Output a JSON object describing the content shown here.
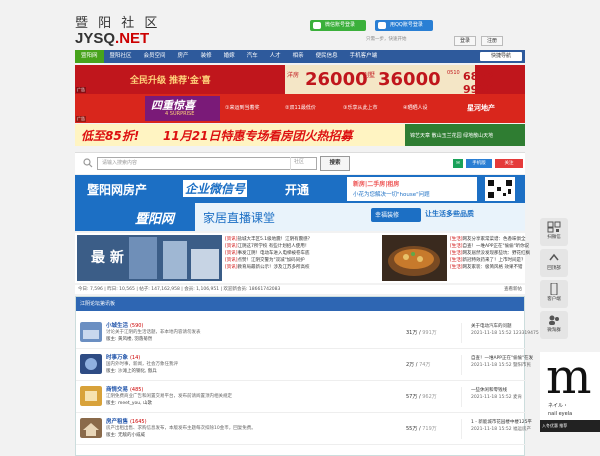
{
  "header": {
    "logo_cn": "暨 阳 社 区",
    "logo_en_a": "JYSQ",
    "logo_en_b": ".NET",
    "wechat_login": "微信账号登录",
    "qq_login": "用QQ账号登录",
    "login_line": "只需一步，快速开始",
    "login_button": "登录",
    "register_button": "注册"
  },
  "nav": {
    "items": [
      "暨阳网",
      "暨阳社区",
      "会员空间",
      "房产",
      "装修",
      "婚嫁",
      "汽车",
      "人才",
      "相亲",
      "便民信息",
      "手机客户端"
    ],
    "quick": "快捷导航"
  },
  "ads": {
    "ad1_left": "全民升级 推荐'金'喜",
    "ad1_num1": "26000",
    "ad1_num2": "36000",
    "ad1_phone_code": "0510",
    "ad1_phone": "6852 9999",
    "ad1_ann": "洋房",
    "ad1_sub": "别墅",
    "ad2_brand": "四重惊喜",
    "ad2_brand_sub": "4 SURPRISE",
    "ad2_items": [
      "①来运到当着奖",
      "②双11最低价",
      "③乐享从此上市",
      "④晒晒人设"
    ],
    "ad2_right": "星河地产",
    "ad3_text_a": "低至85折!",
    "ad3_text_b": "11月21日特惠专场看房团火热招募",
    "ad3_right": "锦艺天章 散山玉兰花园 绿地散山天地",
    "label": "广告"
  },
  "search": {
    "placeholder": "请输入搜索内容",
    "scope": "社区",
    "button": "搜索",
    "phone": "手机版",
    "weibo": "关注"
  },
  "banner1": {
    "text_a": "暨阳网房产",
    "text_b": "企业微信号",
    "text_c": "开通",
    "right_a": "新房|二手房|租房",
    "right_b": "小花为您解决一切\"house\"问题"
  },
  "banner2": {
    "text_a": "暨阳网",
    "text_b": "家居直播课堂",
    "right_a": "幸福装修",
    "right_b": "让生活多些品质"
  },
  "slider_text": "最 新",
  "news_left": [
    {
      "tag": "[资讯]",
      "text": "盐城大丰区5.1级地震！江阴有震感？"
    },
    {
      "tag": "[资讯]",
      "text": "江阴这7所学校 有些计划招人使用！"
    },
    {
      "tag": "[资讯]",
      "text": "事发江阴！电动车进入电梯被卷车底"
    },
    {
      "tag": "[资讯]",
      "text": "点赞！江阴交警为\"双减\"加码同护"
    },
    {
      "tag": "[资讯]",
      "text": "教育局最新公示！涉及江苏多所高校"
    }
  ],
  "news_right": [
    {
      "tag": "[生活]",
      "text": "网友分享家常菜谱：色香味俱全"
    },
    {
      "tag": "[生活]",
      "text": "自查！一堆APP正在\"偷偷\"听你说"
    },
    {
      "tag": "[生活]",
      "text": "网友居然没发现那些坑：野花红枫"
    },
    {
      "tag": "[生活]",
      "text": "新冠特效药来了！上市时间是？"
    },
    {
      "tag": "[生活]",
      "text": "网友家装：极简风格 效果不错"
    }
  ],
  "stats": {
    "text": "今日: 7,596 | 昨日: 10,565 | 帖子: 147,162,958 | 会员: 1,106,951 | 欢迎新会员: 18661742083",
    "right": "查看新帖"
  },
  "forum": {
    "title": "江阴论坛第讯板",
    "rows": [
      {
        "title": "小城生活",
        "count": "(590)",
        "desc": "讨论关于江阴的生活话题，非本地内容请勿发表",
        "mods": "版主: 黄风楼, 羽落菊然",
        "threads": "31万",
        "posts": "991万",
        "latest": "关于电动汽车的问题",
        "date": "2021-11-18 15:52 123319475"
      },
      {
        "title": "时事万象",
        "count": "(14)",
        "desc": "国内外时事，新闻，社会万象任我评",
        "mods": "版主: 沙滩上的钢化, 傲兵",
        "threads": "2万",
        "posts": "74万",
        "latest": "自查！一堆APP正在\"偷偷\"在发",
        "date": "2021-11-18 15:52 暨阳市民"
      },
      {
        "title": "商情交易",
        "count": "(485)",
        "desc": "江阴免费商业广告和闲置交易平台，发布前请阅置顶内相关规定",
        "mods": "版主: meet_you, 山歌",
        "threads": "57万",
        "posts": "962万",
        "latest": "一些休闲和零钱线",
        "date": "2021-11-18 15:52 麦肯"
      },
      {
        "title": "房产租售",
        "count": "(1645)",
        "desc": "房产出租出售、求购信息发布，本版发布主题每次扣除10金币，回复免费。",
        "mods": "版主: 无敌的小威威",
        "threads": "55万",
        "posts": "719万",
        "latest": "1 - 新能城市花园楼中楼125平",
        "date": "2021-11-18 15:52 福运房产"
      }
    ]
  },
  "side_tools": [
    "扫微信",
    "回顶部",
    "客户端",
    "微淘群",
    "我的暨阳"
  ],
  "side_ad": {
    "big": "m",
    "line1": "ネイル・",
    "line2": "nail eyela",
    "bottom": "入冬优惠 推荐"
  },
  "colors": {
    "nav": "#2e5a9c",
    "nav_active": "#47a31c",
    "forum_head": "#2e66b3"
  }
}
